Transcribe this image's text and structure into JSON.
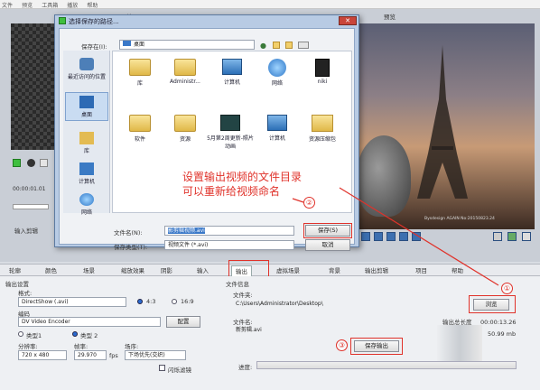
{
  "menu": [
    "文件",
    "预览",
    "工具箱",
    "播放",
    "帮助"
  ],
  "app": {
    "input_label": "输入",
    "preview_label": "预览",
    "time": "00:00:01.01",
    "input_clip_label": "输入剪辑",
    "watermark": "Bysdesign  AGAIN No:20150823.24"
  },
  "tabs": [
    "轮廓",
    "颜色",
    "场景",
    "缩放效果",
    "阴影",
    "输入",
    "输出",
    "虚拟场景",
    "背景",
    "输出剪辑",
    "项目",
    "帮助"
  ],
  "output_settings": {
    "section_label": "输出设置",
    "format_label": "格式:",
    "format_value": "DirectShow (.avi)",
    "ratio_43": "4:3",
    "ratio_169": "16:9",
    "codec_label": "编码",
    "codec_value": "DV Video Encoder",
    "config_button": "配置",
    "type1": "类型1",
    "type2": "类型 2",
    "resolution_label": "分辨率:",
    "resolution_value": "720 x 480",
    "fps_label": "帧率:",
    "fps_value": "29.970",
    "fps_unit": "fps",
    "scene_label": "场序:",
    "scene_value": "下场优先(交织)",
    "flicker_label": "闪烁滤镜"
  },
  "file_info": {
    "section_label": "文件信息",
    "folder_label": "文件夹:",
    "folder_value": "C:\\Users\\Administrator\\Desktop\\",
    "browse_button": "浏览",
    "filename_label": "文件名:",
    "filename_value": "新剪辑.avi",
    "total_length_label": "输出总长度",
    "total_length_value": "00:00:13.26",
    "size_value": "50.99 mb",
    "save_output_button": "保存输出",
    "progress_label": "进度:"
  },
  "dialog": {
    "title": "选择保存的路径...",
    "save_in_label": "保存在(I):",
    "save_in_value": "桌面",
    "places": [
      "最近访问的位置",
      "桌面",
      "库",
      "计算机",
      "网络"
    ],
    "files": [
      {
        "name": "库",
        "icon": "folder-icon"
      },
      {
        "name": "Administr...",
        "icon": "user-folder-icon"
      },
      {
        "name": "计算机",
        "icon": "computer-icon"
      },
      {
        "name": "网络",
        "icon": "network-icon"
      },
      {
        "name": "niki",
        "icon": "user-icon"
      },
      {
        "name": "软件",
        "icon": "folder-icon"
      },
      {
        "name": "资源",
        "icon": "folder-icon"
      },
      {
        "name": "5月第2周更新-照片动画",
        "icon": "video-icon"
      },
      {
        "name": "计算机",
        "icon": "computer-icon"
      },
      {
        "name": "资源压缩包",
        "icon": "zip-folder-icon"
      }
    ],
    "filename_label": "文件名(N):",
    "filename_value": "影剪辑视频.avi",
    "filetype_label": "保存类型(T):",
    "filetype_value": "视频文件 (*.avi)",
    "save_button": "保存(S)",
    "cancel_button": "取消"
  },
  "annotation": {
    "line1": "设置输出视频的文件目录",
    "line2": "可以重新给视频命名",
    "step1": "①",
    "step2": "②",
    "step3": "③"
  },
  "colors": {
    "accent_red": "#e0322a",
    "dialog_frame": "#b8cbe4"
  }
}
